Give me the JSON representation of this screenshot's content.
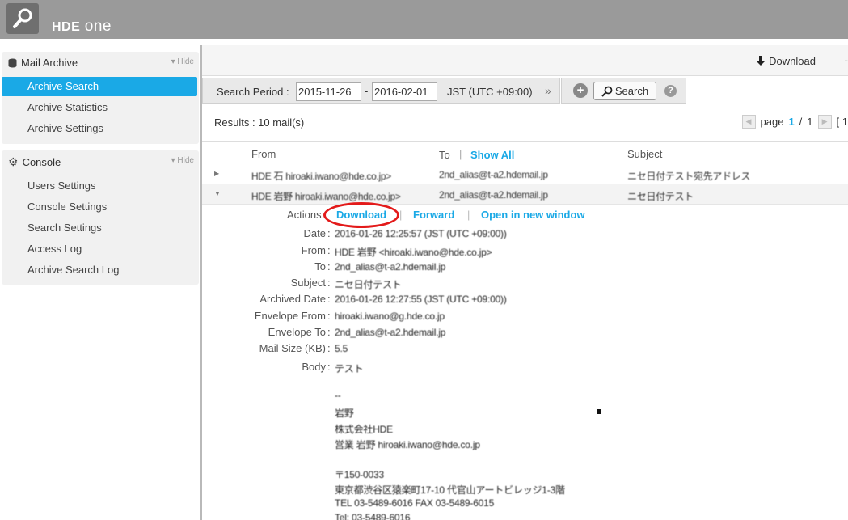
{
  "brand": {
    "hde": "HDE",
    "one": "one"
  },
  "sidebar": {
    "mail_archive": {
      "title": "Mail Archive",
      "hide": "Hide",
      "items": [
        {
          "label": "Archive Search",
          "active": true
        },
        {
          "label": "Archive Statistics"
        },
        {
          "label": "Archive Settings"
        }
      ]
    },
    "console": {
      "title": "Console",
      "hide": "Hide",
      "items": [
        {
          "label": "Users Settings"
        },
        {
          "label": "Console Settings"
        },
        {
          "label": "Search Settings"
        },
        {
          "label": "Access Log"
        },
        {
          "label": "Archive Search Log"
        }
      ]
    }
  },
  "toolbar": {
    "download": "Download"
  },
  "search": {
    "period_label": "Search Period :",
    "date_from": "2015-11-26",
    "date_dash": "-",
    "date_to": "2016-02-01",
    "timezone": "JST (UTC +09:00)",
    "search_button": "Search"
  },
  "results": {
    "text": "Results :  10 mail(s)",
    "page_label": "page",
    "page_current": "1",
    "page_sep": "/",
    "page_total": "1",
    "page_tail": "[ 1"
  },
  "list": {
    "headers": {
      "from": "From",
      "to": "To",
      "show_all": "Show All",
      "subject": "Subject"
    },
    "rows": [
      {
        "from": "HDE 石 hiroaki.iwano@hde.co.jp>",
        "to": "2nd_alias@t-a2.hdemail.jp",
        "subject": "ニセ日付テスト宛先アドレス"
      },
      {
        "from": "HDE 岩野 hiroaki.iwano@hde.co.jp>",
        "to": "2nd_alias@t-a2.hdemail.jp",
        "subject": "ニセ日付テスト"
      }
    ]
  },
  "detail": {
    "actions_label": "Actions",
    "action_download": "Download",
    "action_forward": "Forward",
    "action_open": "Open in new window",
    "fields": [
      {
        "label": "Date",
        "value": "2016-01-26  12:25:57 (JST (UTC +09:00))"
      },
      {
        "label": "From",
        "value": "HDE 岩野 <hiroaki.iwano@hde.co.jp>"
      },
      {
        "label": "To",
        "value": "2nd_alias@t-a2.hdemail.jp"
      },
      {
        "label": "Subject",
        "value": "ニセ日付テスト"
      },
      {
        "label": "Archived Date",
        "value": "2016-01-26  12:27:55 (JST (UTC +09:00))"
      },
      {
        "label": "Envelope From",
        "value": "hiroaki.iwano@g.hde.co.jp"
      },
      {
        "label": "Envelope To",
        "value": "2nd_alias@t-a2.hdemail.jp"
      },
      {
        "label": "Mail Size (KB)",
        "value": "5.5"
      },
      {
        "label": "Body",
        "value": "テスト"
      }
    ],
    "body_lines": [
      "--",
      "岩野",
      "株式会社HDE",
      "営業  岩野 hiroaki.iwano@hde.co.jp",
      "",
      "〒150-0033",
      "東京都渋谷区猿楽町17-10 代官山アートビレッジ1-3階",
      "TEL 03-5489-6016 FAX 03-5489-6015",
      "Tel: 03-5489-6016"
    ]
  }
}
